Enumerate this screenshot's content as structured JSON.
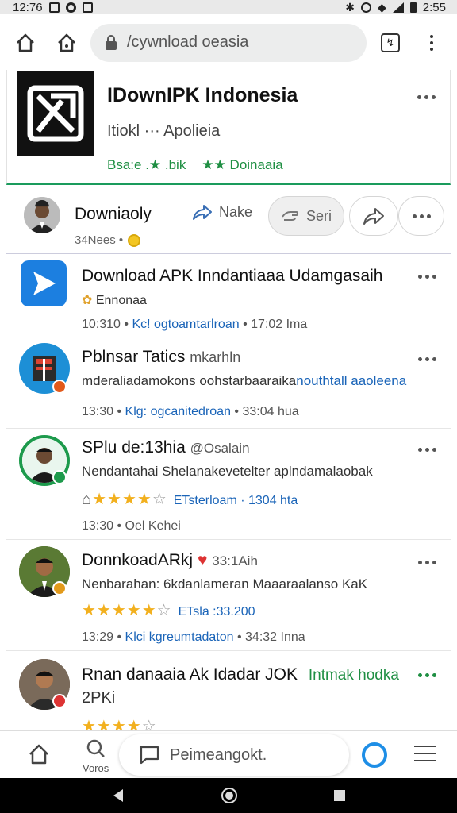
{
  "status_bar": {
    "time_left": "12:76",
    "time_right": "2:55"
  },
  "browser": {
    "url": "/cywnload oeasia"
  },
  "header": {
    "title": "IDownIPK Indonesia",
    "subtitle": "Itiokl ··· Apolieia",
    "tag_left": "Bsa:e .★ .bik",
    "tag_right": "★★ Doinaaia"
  },
  "author": {
    "name": "Downiaoly",
    "meta": "34Nees •",
    "make_label": "Nake",
    "send_label": "Seri"
  },
  "feed": [
    {
      "title": "Download APK Inndantiaaa Udamgasaih",
      "sub": "Ennonaa",
      "time": "10:310",
      "link": "Kc! ogtoamtarlroan",
      "extra": "17:02 Ima"
    },
    {
      "title": "Pblnsar Tatics",
      "title_tail": "mkarhln",
      "sub": "mderaliadamokons oohstarbaaraika",
      "sub_tail": "nouthtall aaoleena",
      "time": "13:30",
      "link": "Klg: ogcanitedroan",
      "extra": "33:04 hua"
    },
    {
      "title": "SPlu de:13hia",
      "title_tail": "@Osalain",
      "sub": "Nendantahai Shelanakevetelter aplndamalaobak",
      "stars_label": "ETsterloam · 1304 hta",
      "time": "13:30",
      "extra": "Oel Kehei"
    },
    {
      "title": "DonnkoadARkj",
      "title_tail": "33:1Aih",
      "sub": "Nenbarahan: 6kdanlameran Maaaraalanso KaK",
      "stars_label": "ETsla :33.200",
      "time": "13:29",
      "link": "Klci kgreumtadaton",
      "extra": "34:32 Inna"
    },
    {
      "title": "Rnan danaaia Ak Idadar JOK",
      "title_tail": "Intmak hodka",
      "sub": "2PKi"
    }
  ],
  "bottom": {
    "search_label": "Voros",
    "compose_placeholder": "Peimeangokt."
  },
  "icons": {
    "status": [
      "sim-icon",
      "data-icon",
      "notification-icon",
      "bluetooth-icon",
      "alarm-icon",
      "wifi-icon",
      "signal-icon",
      "battery-icon"
    ],
    "browser": [
      "home-icon",
      "home-alt-icon",
      "lock-icon",
      "tabs-icon",
      "overflow-menu-icon"
    ]
  },
  "colors": {
    "accent_green": "#1f8f43",
    "link_blue": "#1a64b8",
    "star": "#f2b01e",
    "refresh_blue": "#1e8ee6"
  }
}
